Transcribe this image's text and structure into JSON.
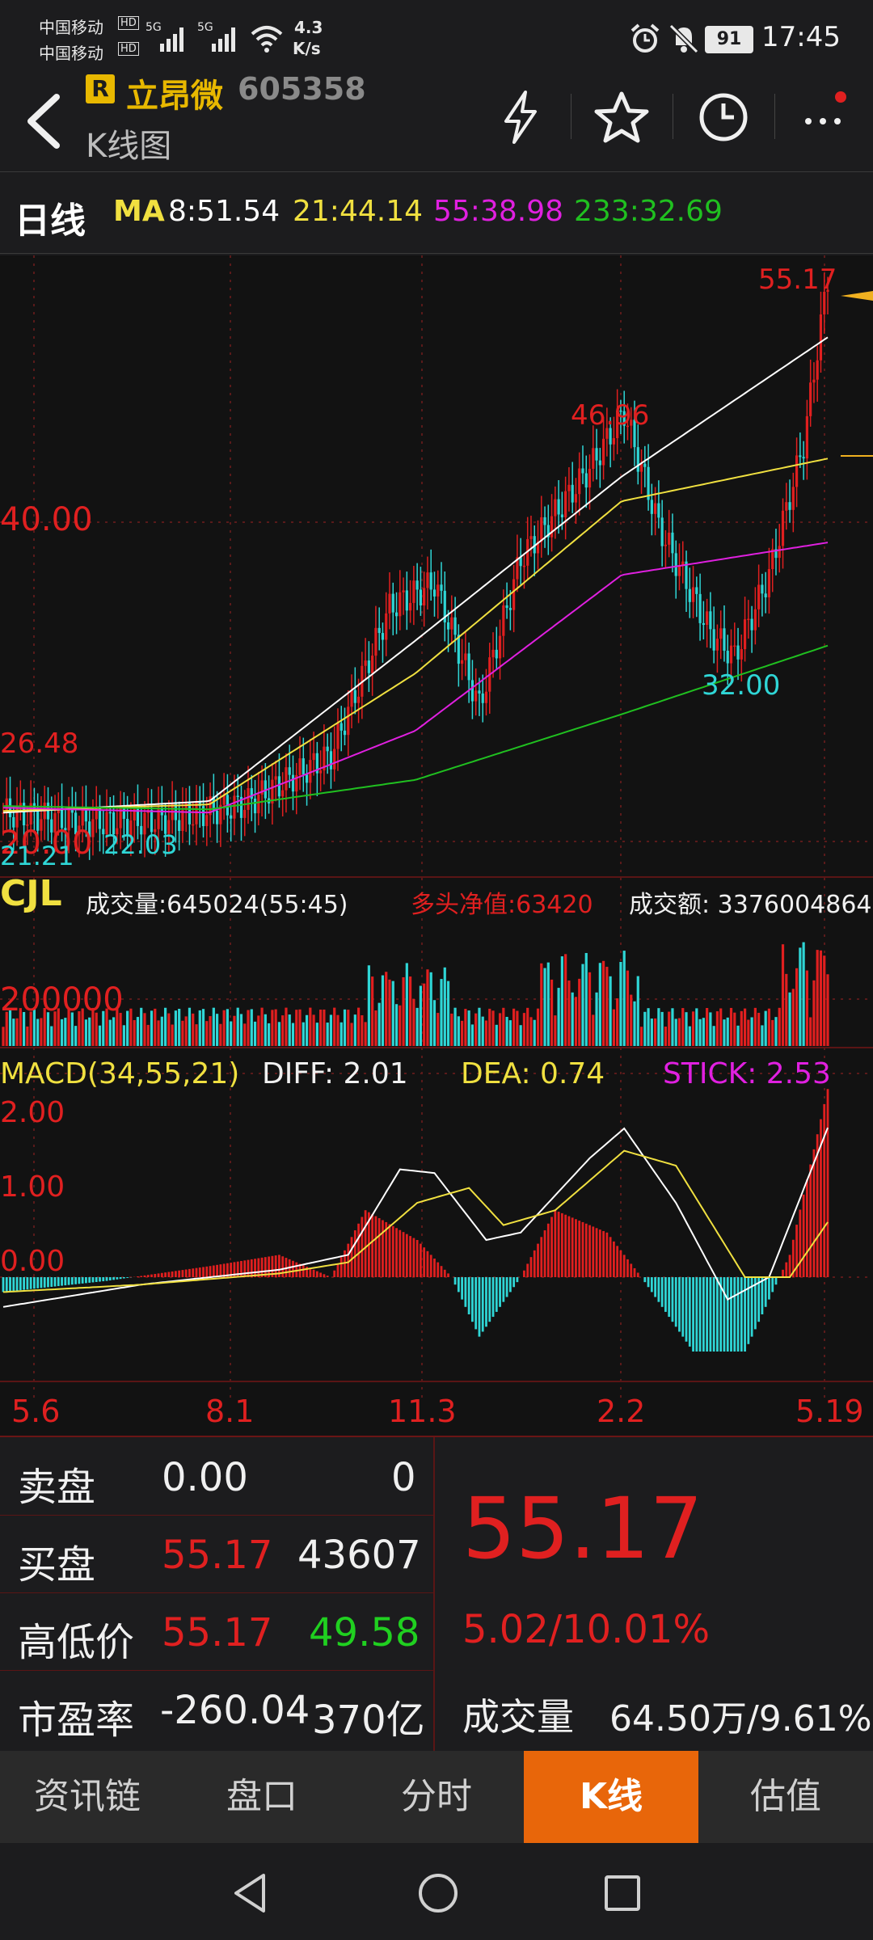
{
  "status_bar": {
    "carrier1": "中国移动",
    "carrier2": "中国移动",
    "hd": "HD",
    "net1": "5G",
    "net2": "5G",
    "speed_value": "4.3",
    "speed_unit": "K/s",
    "battery": "91",
    "time": "17:45"
  },
  "header": {
    "badge": "R",
    "stock_name": "立昂微",
    "stock_code": "605358",
    "subtitle": "K线图"
  },
  "ma_bar": {
    "period": "日线",
    "ma_label": "MA",
    "ma8": "8:51.54",
    "ma21": "21:44.14",
    "ma55": "55:38.98",
    "ma233": "233:32.69"
  },
  "kline_panel": {
    "high_label": "55.17",
    "peak_mid_label": "46.96",
    "low_mid_label": "32.00",
    "level_40": "40.00",
    "level_26": "26.48",
    "level_20": "20.00",
    "low_left": "21.21",
    "low_2": "22.03"
  },
  "volume_panel": {
    "title": "CJL",
    "volume": "成交量:645024(55:45)",
    "net_long": "多头净值:63420",
    "turnover": "成交额: 3376004864",
    "level": "200000"
  },
  "macd_panel": {
    "title": "MACD(34,55,21)",
    "diff": "DIFF: 2.01",
    "dea": "DEA: 0.74",
    "stick": "STICK: 2.53",
    "tick_2": "2.00",
    "tick_1": "1.00",
    "tick_0": "0.00"
  },
  "x_axis": [
    "5.6",
    "8.1",
    "11.3",
    "2.2",
    "5.19"
  ],
  "quote": {
    "sell_label": "卖盘",
    "sell_price": "0.00",
    "sell_vol": "0",
    "buy_label": "买盘",
    "buy_price": "55.17",
    "buy_vol": "43607",
    "hl_label": "高低价",
    "high": "55.17",
    "low": "49.58",
    "pe_label": "市盈率",
    "pe": "-260.04",
    "mcap": "370亿",
    "last_price": "55.17",
    "change": "5.02/10.01%",
    "vol_label": "成交量",
    "vol_value": "64.50万/9.61%"
  },
  "tabs": [
    "资讯链",
    "盘口",
    "分时",
    "K线",
    "估值"
  ],
  "colors": {
    "up": "#e01f1f",
    "down": "#2fd6d6",
    "ma8": "#ffffff",
    "ma21": "#f0e040",
    "ma55": "#e020e0",
    "ma233": "#20c020",
    "accent": "#e8660a"
  },
  "chart_data": [
    {
      "type": "line",
      "x": [
        "5.6",
        "8.1",
        "11.3",
        "2.2",
        "5.19"
      ],
      "price_labels": {
        "max": 55.17,
        "local_high": 46.96,
        "local_low": 32.0,
        "start_low": 21.21
      },
      "ylim": [
        20,
        56
      ],
      "series": [
        {
          "name": "MA8",
          "values": [
            22.5,
            23.2,
            33.0,
            43.0,
            51.5
          ]
        },
        {
          "name": "MA21",
          "values": [
            22.6,
            23.0,
            31.0,
            41.5,
            44.1
          ]
        },
        {
          "name": "MA55",
          "values": [
            22.8,
            22.5,
            27.5,
            37.0,
            38.98
          ]
        },
        {
          "name": "MA233",
          "values": [
            22.9,
            22.7,
            24.5,
            28.5,
            32.69
          ]
        }
      ]
    },
    {
      "type": "bar",
      "title": "MACD(34,55,21)",
      "ylim": [
        -1.5,
        2.2
      ],
      "series": [
        {
          "name": "DIFF",
          "values": [
            -0.3,
            0.2,
            1.4,
            1.9,
            2.01
          ]
        },
        {
          "name": "DEA",
          "values": [
            -0.1,
            0.1,
            1.2,
            1.6,
            0.74
          ]
        },
        {
          "name": "STICK",
          "values": [
            -0.2,
            0.1,
            0.5,
            0.7,
            2.53
          ]
        }
      ]
    }
  ]
}
